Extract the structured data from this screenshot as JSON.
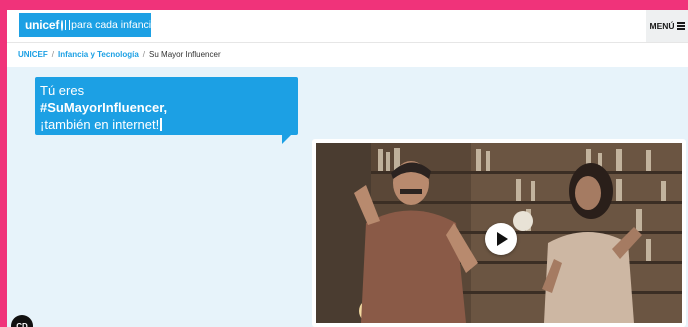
{
  "header": {
    "logo_brand": "unicef",
    "logo_tagline": "para cada infancia",
    "menu_label": "MENÚ"
  },
  "breadcrumb": {
    "items": [
      "UNICEF",
      "Infancia y Tecnología",
      "Su Mayor Influencer"
    ],
    "separator": "/"
  },
  "hero": {
    "bubble_line1": "Tú eres",
    "bubble_line2": "#SuMayorInfluencer,",
    "bubble_line3": "¡también en internet!"
  },
  "floating_button": {
    "label": "CD"
  },
  "colors": {
    "page_border": "#f0337a",
    "unicef_blue": "#1ca0e4",
    "hero_background": "#e7f3fa"
  },
  "icons": {
    "menu": "hamburger-icon",
    "logo": "globe-icon",
    "video": "play-icon"
  }
}
